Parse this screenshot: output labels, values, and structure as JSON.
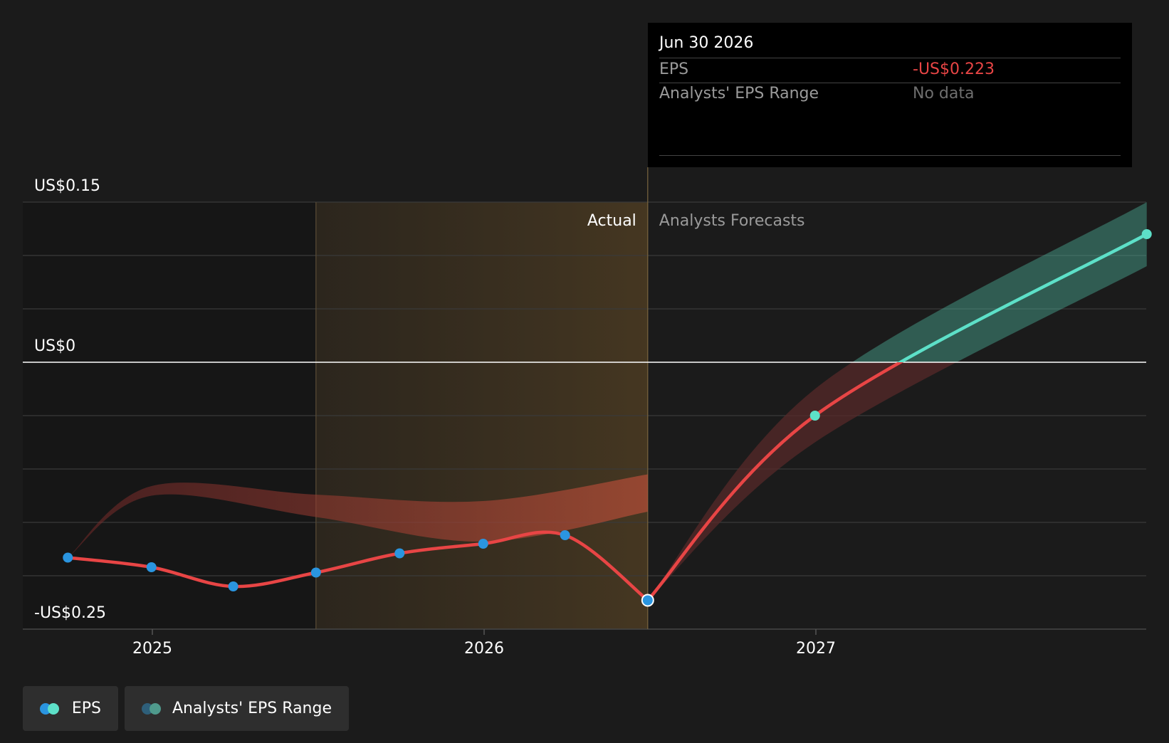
{
  "chart_data": {
    "type": "line",
    "x_ticks": [
      "2025",
      "2026",
      "2027"
    ],
    "y_ticks": [
      "US$0.15",
      "US$0",
      "-US$0.25"
    ],
    "ylim": [
      -0.25,
      0.15
    ],
    "grid": true,
    "region_labels": {
      "actual": "Actual",
      "forecast": "Analysts Forecasts"
    },
    "series": [
      {
        "name": "EPS",
        "kind": "actual",
        "color": "#e84545",
        "marker_color": "#2a95e0",
        "points": [
          {
            "x": "2024-09-30",
            "y": -0.183
          },
          {
            "x": "2024-12-31",
            "y": -0.192
          },
          {
            "x": "2025-03-31",
            "y": -0.21
          },
          {
            "x": "2025-06-30",
            "y": -0.197
          },
          {
            "x": "2025-09-30",
            "y": -0.179
          },
          {
            "x": "2025-12-31",
            "y": -0.17
          },
          {
            "x": "2026-03-31",
            "y": -0.162
          },
          {
            "x": "2026-06-30",
            "y": -0.223
          }
        ]
      },
      {
        "name": "EPS",
        "kind": "forecast",
        "color": "#e84545",
        "color_above_zero": "#5de0c8",
        "points": [
          {
            "x": "2026-06-30",
            "y": -0.223
          },
          {
            "x": "2026-12-31",
            "y": -0.05
          },
          {
            "x": "2027-12-31",
            "y": 0.12
          }
        ]
      },
      {
        "name": "Analysts' EPS Range",
        "kind": "range",
        "color": "#4fb8a0",
        "points": [
          {
            "x": "2026-06-30",
            "low": -0.223,
            "high": -0.223
          },
          {
            "x": "2026-12-31",
            "low": -0.075,
            "high": -0.025
          },
          {
            "x": "2027-12-31",
            "low": 0.09,
            "high": 0.15
          }
        ]
      }
    ]
  },
  "tooltip": {
    "date": "Jun 30 2026",
    "rows": [
      {
        "label": "EPS",
        "value": "-US$0.223",
        "value_color": "#e84545"
      },
      {
        "label": "Analysts' EPS Range",
        "value": "No data",
        "value_color": "#6e6e6e"
      }
    ]
  },
  "legend": [
    {
      "label": "EPS",
      "colors": [
        "#2a95e0",
        "#5de0c8"
      ]
    },
    {
      "label": "Analysts' EPS Range",
      "colors": [
        "#2e5f7a",
        "#4f9a8c"
      ]
    }
  ]
}
